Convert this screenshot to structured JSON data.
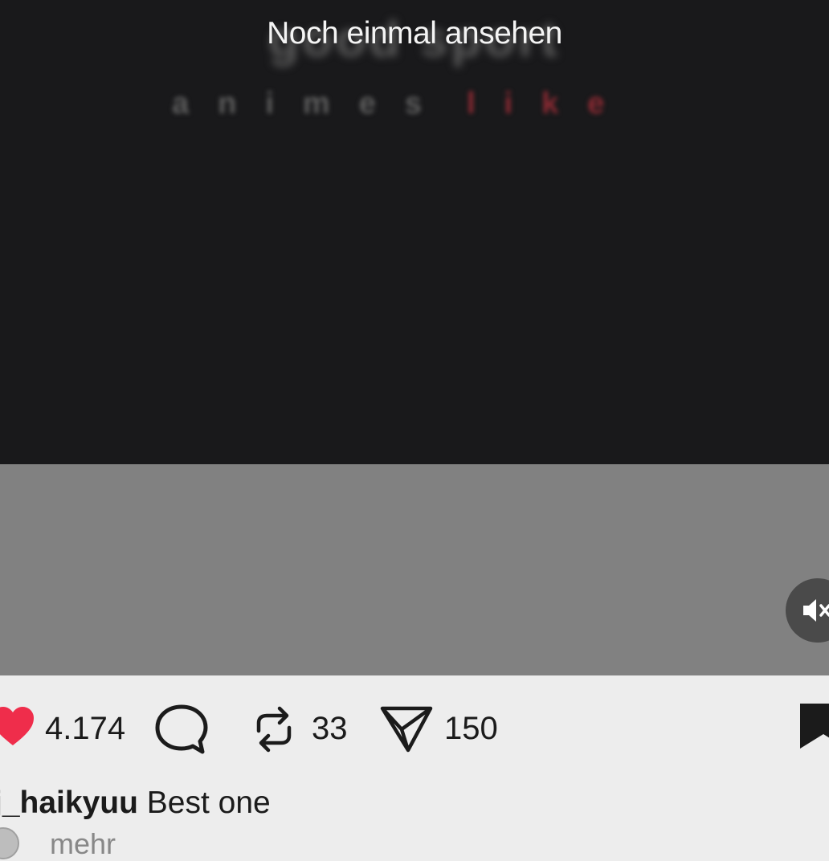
{
  "video": {
    "replay_label": "Noch einmal ansehen",
    "bg_title": "good sport",
    "bg_sub_1": "animes",
    "bg_sub_2": "like"
  },
  "controls": {
    "mute_icon": "speaker-muted-icon"
  },
  "actions": {
    "likes": "4.174",
    "reposts": "33",
    "shares": "150",
    "icons": [
      "heart-icon",
      "comment-icon",
      "repost-icon",
      "send-icon",
      "bookmark-icon"
    ],
    "like_color": "#ef2d4b"
  },
  "caption": {
    "username": "j_haikyuu",
    "text": "Best one",
    "more_label": "mehr"
  }
}
